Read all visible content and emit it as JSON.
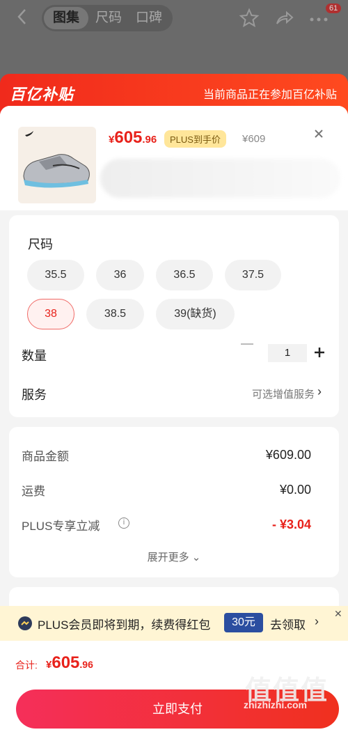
{
  "nav": {
    "tabs": [
      "图集",
      "尺码",
      "口碑"
    ],
    "badge_count": "61"
  },
  "banner": {
    "logo": "百亿补贴",
    "text": "当前商品正在参加百亿补贴"
  },
  "product": {
    "price_yen": "¥",
    "price_main": "605",
    "price_decimal": ".96",
    "plus_tag": "PLUS到手价",
    "original_price": "¥609"
  },
  "options": {
    "size_title": "尺码",
    "sizes": [
      "35.5",
      "36",
      "36.5",
      "37.5",
      "38",
      "38.5",
      "39(缺货)"
    ],
    "selected_size": "38",
    "qty_label": "数量",
    "qty_value": "1",
    "service_label": "服务",
    "service_value": "可选增值服务"
  },
  "fees": {
    "goods_label": "商品金额",
    "goods_value": "¥609.00",
    "shipping_label": "运费",
    "shipping_value": "¥0.00",
    "plus_discount_label": "PLUS专享立减",
    "plus_discount_value": "- ¥3.04",
    "expand_label": "展开更多"
  },
  "plus_strip": {
    "text": "PLUS会员即将到期，续费得红包",
    "amount": "30元",
    "claim": "去领取"
  },
  "bottom": {
    "total_label": "合计:",
    "total_yen": "¥",
    "total_main": "605",
    "total_decimal": ".96",
    "pay_button": "立即支付",
    "watermark_big": "值值值",
    "watermark": "zhizhizhi.com"
  },
  "colors": {
    "accent_red": "#e8221b",
    "plus_blue": "#2b4ea0",
    "plus_gold": "#ffe69a"
  }
}
